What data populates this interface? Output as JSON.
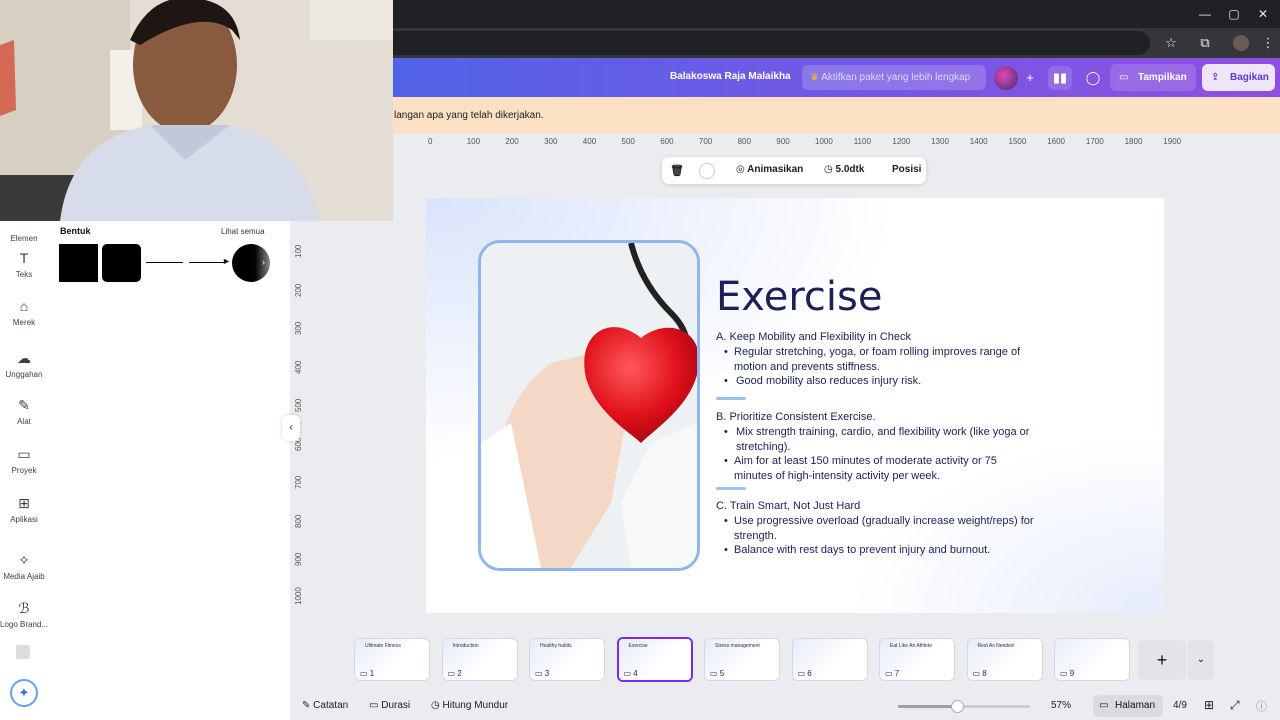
{
  "window": {
    "minimize": "—",
    "maximize": "▢",
    "close": "✕"
  },
  "header": {
    "project_name": "Balakoswa Raja Malaikha",
    "upgrade_label": "Aktifkan paket yang lebih lengkap",
    "present_label": "Tampilkan",
    "share_label": "Bagikan"
  },
  "notice": {
    "text": "langan apa yang telah dikerjakan."
  },
  "ruler": {
    "horizontal": [
      "0",
      "100",
      "200",
      "300",
      "400",
      "500",
      "600",
      "700",
      "800",
      "900",
      "1000",
      "1100",
      "1200",
      "1300",
      "1400",
      "1500",
      "1600",
      "1700",
      "1800",
      "1900"
    ],
    "vertical": [
      "100",
      "200",
      "300",
      "400",
      "500",
      "600",
      "700",
      "800",
      "900",
      "1000"
    ]
  },
  "rail": {
    "items": [
      {
        "label": "Elemen",
        "icon": "elements-icon"
      },
      {
        "label": "Teks",
        "icon": "text-icon"
      },
      {
        "label": "Merek",
        "icon": "brand-icon"
      },
      {
        "label": "Unggahan",
        "icon": "upload-icon"
      },
      {
        "label": "Alat",
        "icon": "draw-icon"
      },
      {
        "label": "Proyek",
        "icon": "folder-icon"
      },
      {
        "label": "Aplikasi",
        "icon": "apps-icon"
      },
      {
        "label": "Media Ajaib",
        "icon": "magic-media-icon"
      },
      {
        "label": "Logo Brand...",
        "icon": "logo-brand-icon"
      }
    ]
  },
  "panel": {
    "section_title": "Bentuk",
    "see_all": "Lihat semua"
  },
  "floatbar": {
    "animate_label": "Animasikan",
    "duration_label": "5.0dtk",
    "position_label": "Posisi"
  },
  "slide": {
    "title": "Exercise",
    "sections": [
      {
        "heading": "A. Keep Mobility and Flexibility in Check",
        "bullets": [
          "Regular stretching, yoga, or foam rolling improves range of motion and prevents stiffness.",
          "Good mobility also reduces injury risk."
        ]
      },
      {
        "heading": "B. Prioritize Consistent Exercise.",
        "bullets": [
          "Mix strength training, cardio, and flexibility work (like yoga or stretching).",
          "Aim for at least 150 minutes of moderate activity or 75 minutes of high-intensity activity per week."
        ]
      },
      {
        "heading": "C. Train Smart, Not Just Hard",
        "bullets": [
          "Use progressive overload (gradually increase weight/reps) for strength.",
          "Balance with rest days to prevent injury and burnout."
        ]
      }
    ]
  },
  "thumbnails": [
    {
      "num": "1",
      "title": "Ultimate Fitness"
    },
    {
      "num": "2",
      "title": "Introduction"
    },
    {
      "num": "3",
      "title": "Healthy habits"
    },
    {
      "num": "4",
      "title": "Exercise"
    },
    {
      "num": "5",
      "title": "Stress management"
    },
    {
      "num": "6",
      "title": ""
    },
    {
      "num": "7",
      "title": "Eat Like An Athlete"
    },
    {
      "num": "8",
      "title": "Rest As Needed"
    },
    {
      "num": "9",
      "title": ""
    }
  ],
  "bottombar": {
    "notes_label": "Catatan",
    "duration_label": "Durasi",
    "countdown_label": "Hitung Mundur",
    "zoom": "57%",
    "zoom_fraction": 0.45,
    "pages_label": "Halaman",
    "page_indicator": "4/9"
  },
  "colors": {
    "accent": "#7d2ae8",
    "slide_title": "#1b2157",
    "header_start": "#2f6ce8",
    "header_end": "#8f4fe0"
  }
}
